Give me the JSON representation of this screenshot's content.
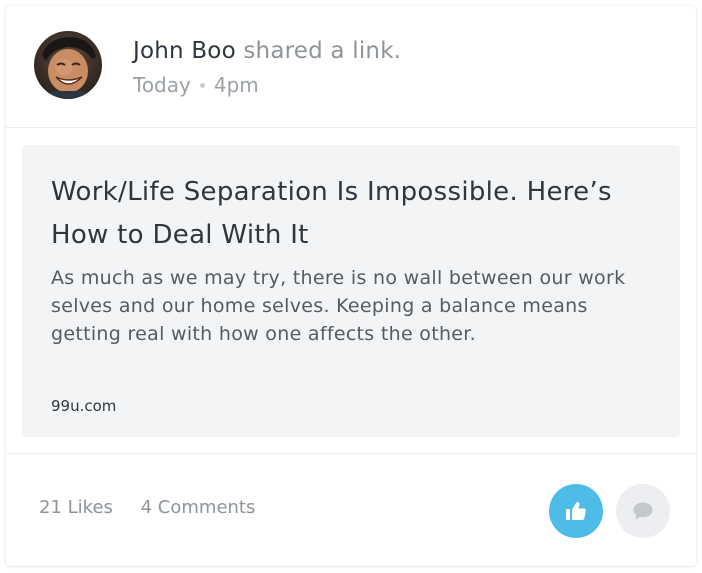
{
  "post": {
    "author": {
      "name": "John Boo",
      "avatar_icon": "user-photo-avatar"
    },
    "action": "shared a link.",
    "date": "Today",
    "time": "4pm"
  },
  "link": {
    "title": "Work/Life Separation Is Impossible. Here’s How to Deal With It",
    "description": "As much as we may try, there is no wall between our work selves and our home selves. Keeping a balance means getting real with how one affects the other.",
    "domain": "99u.com"
  },
  "stats": {
    "likes": "21 Likes",
    "comments": "4 Comments"
  },
  "actions": {
    "like_icon": "thumbs-up-icon",
    "comment_icon": "speech-bubble-icon"
  },
  "colors": {
    "like_button_bg": "#4dbde8",
    "comment_button_bg": "#eceef1",
    "comment_icon": "#c3c8cd",
    "preview_bg": "#f3f4f6"
  }
}
